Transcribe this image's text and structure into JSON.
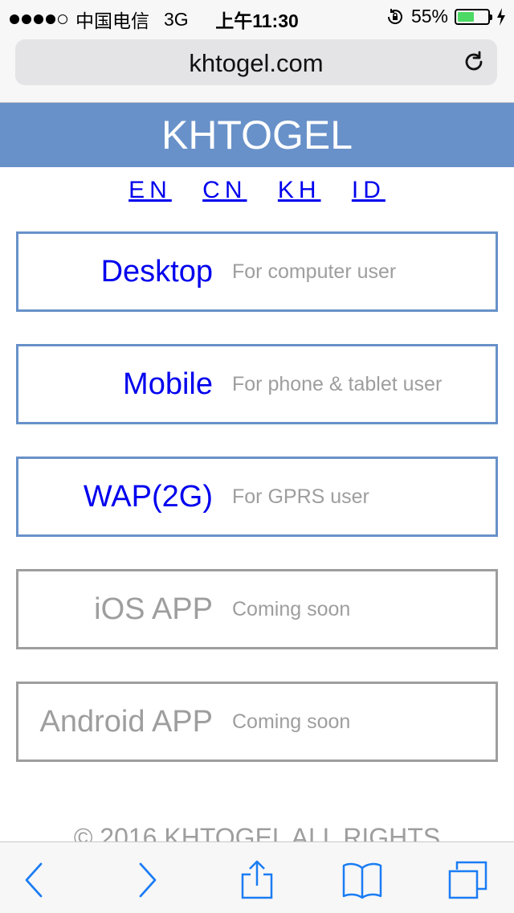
{
  "status_bar": {
    "carrier": "中国电信",
    "network": "3G",
    "time": "上午11:30",
    "battery_percent": "55%",
    "battery_level": 0.55,
    "signal_bars_filled": 4,
    "signal_bars_total": 5
  },
  "browser": {
    "url": "khtogel.com"
  },
  "site": {
    "title": "KHTOGEL",
    "languages": [
      "EN",
      "CN",
      "KH",
      "ID"
    ],
    "options": [
      {
        "title": "Desktop",
        "subtitle": "For computer user",
        "enabled": true
      },
      {
        "title": "Mobile",
        "subtitle": "For phone & tablet user",
        "enabled": true
      },
      {
        "title": "WAP(2G)",
        "subtitle": "For GPRS user",
        "enabled": true
      },
      {
        "title": "iOS APP",
        "subtitle": "Coming soon",
        "enabled": false
      },
      {
        "title": "Android APP",
        "subtitle": "Coming soon",
        "enabled": false
      }
    ],
    "footer": "© 2016 KHTOGEL ALL RIGHTS"
  },
  "colors": {
    "header_bg": "#6891c9",
    "link": "#0000ee",
    "disabled": "#9e9e9e",
    "ios_blue": "#1a7cf4",
    "battery_green": "#4cd964"
  },
  "icons": {
    "reload": "reload-icon",
    "back": "chevron-left-icon",
    "forward": "chevron-right-icon",
    "share": "share-icon",
    "bookmarks": "book-icon",
    "tabs": "tabs-icon"
  }
}
